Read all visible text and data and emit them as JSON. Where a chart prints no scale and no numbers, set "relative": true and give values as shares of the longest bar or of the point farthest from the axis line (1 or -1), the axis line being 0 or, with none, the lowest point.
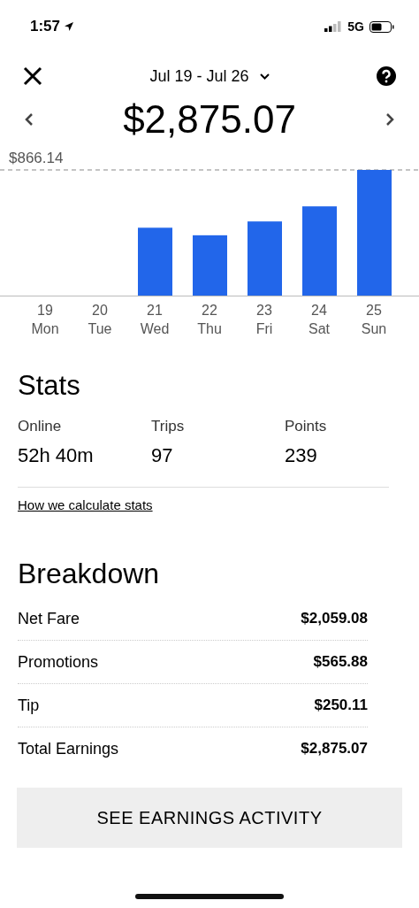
{
  "status_bar": {
    "time": "1:57",
    "network": "5G"
  },
  "header": {
    "date_range": "Jul 19 - Jul 26",
    "total": "$2,875.07"
  },
  "chart": {
    "chart_data": {
      "type": "bar",
      "relative": true,
      "categories": [
        "19 Mon",
        "20 Tue",
        "21 Wed",
        "22 Thu",
        "23 Fri",
        "24 Sat",
        "25 Sun"
      ],
      "values": [
        null,
        null,
        0.54,
        0.48,
        0.59,
        0.71,
        1
      ],
      "annotations": [
        "$866.14"
      ]
    }
  },
  "stats": {
    "title": "Stats",
    "items": [
      {
        "label": "Online",
        "value": "52h 40m"
      },
      {
        "label": "Trips",
        "value": "97"
      },
      {
        "label": "Points",
        "value": "239"
      }
    ],
    "link": "How we calculate stats"
  },
  "breakdown": {
    "title": "Breakdown",
    "rows": [
      {
        "label": "Net Fare",
        "amount": "$2,059.08"
      },
      {
        "label": "Promotions",
        "amount": "$565.88"
      },
      {
        "label": "Tip",
        "amount": "$250.11"
      },
      {
        "label": "Total Earnings",
        "amount": "$2,875.07"
      }
    ]
  },
  "button": "SEE EARNINGS ACTIVITY"
}
